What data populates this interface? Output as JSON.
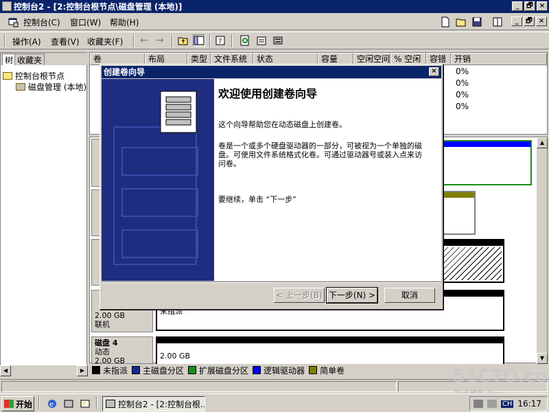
{
  "window": {
    "title": "控制台2 - [2:控制台根节点\\磁盘管理 (本地)]",
    "buttons": [
      "_",
      "🗗",
      "×"
    ]
  },
  "menubar": {
    "items": [
      "控制台(C)",
      "窗口(W)",
      "帮助(H)"
    ]
  },
  "actionbar": {
    "items": [
      "操作(A)",
      "查看(V)",
      "收藏夹(F)"
    ]
  },
  "tree": {
    "tabs": [
      "树",
      "收藏夹"
    ],
    "root": "控制台根节点",
    "child": "磁盘管理 (本地)"
  },
  "volume_list": {
    "columns": [
      "卷",
      "布局",
      "类型",
      "文件系统",
      "状态",
      "容量",
      "空闲空间",
      "% 空闲",
      "容错",
      "开销"
    ],
    "overhead_values": [
      "0%",
      "0%",
      "0%",
      "0%"
    ]
  },
  "disks": [
    {
      "name": "磁盘 4",
      "type": "动态",
      "size": "2.00 GB",
      "status": "联机"
    },
    {
      "size": "2.00 GB",
      "status": "联机",
      "part_size": "2.00 GB",
      "part_label": "未指派"
    },
    {
      "part_size": "2.00 GB"
    }
  ],
  "legend": [
    {
      "label": "未指派",
      "color": "#000000"
    },
    {
      "label": "主磁盘分区",
      "color": "#1a2a8c"
    },
    {
      "label": "扩展磁盘分区",
      "color": "#1a8c1a"
    },
    {
      "label": "逻辑驱动器",
      "color": "#0000ff"
    },
    {
      "label": "简单卷",
      "color": "#808000"
    }
  ],
  "wizard": {
    "title": "创建卷向导",
    "heading": "欢迎使用创建卷向导",
    "para1": "这个向导帮助您在动态磁盘上创建卷。",
    "para2": "卷是一个或多个硬盘驱动器的一部分，可被视为一个单独的磁盘。可使用文件系统格式化卷。可通过驱动器号或装入点来访问卷。",
    "para3": "要继续，单击 “下一步”",
    "back_button": "< 上一步(B)",
    "next_button": "下一步(N) >",
    "cancel_button": "取消"
  },
  "taskbar": {
    "start": "开始",
    "task": "控制台2 - [2:控制台根...",
    "lang": "CH",
    "clock": "16:17"
  },
  "watermark": {
    "main": "51CTO.com",
    "sub": "技术博客 Blog"
  }
}
